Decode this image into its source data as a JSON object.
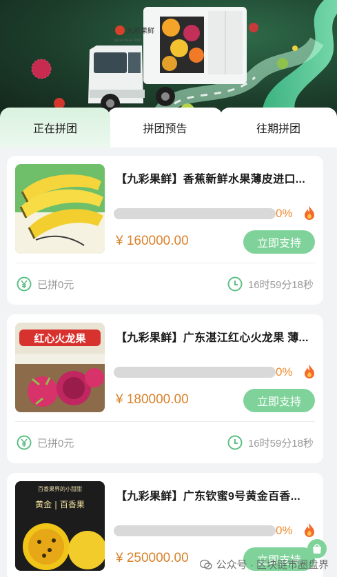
{
  "banner": {
    "logo_text": "九彩果鲜",
    "logo_sub": "JIUCAI FRESH FRUIT"
  },
  "tabs": [
    {
      "label": "正在拼团",
      "active": true
    },
    {
      "label": "拼团预告",
      "active": false
    },
    {
      "label": "往期拼团",
      "active": false
    }
  ],
  "products": [
    {
      "title": "【九彩果鲜】香蕉新鲜水果薄皮进口...",
      "progress_percent": 0,
      "progress_label": "0%",
      "price": "¥ 160000.00",
      "support_label": "立即支持",
      "joined_text": "已拼0元",
      "timer_text": "16时59分18秒",
      "image": "banana-bunch"
    },
    {
      "title": "【九彩果鲜】广东湛江红心火龙果 薄...",
      "progress_percent": 0,
      "progress_label": "0%",
      "price": "¥ 180000.00",
      "support_label": "立即支持",
      "joined_text": "已拼0元",
      "timer_text": "16时59分18秒",
      "image": "dragon-fruit",
      "image_caption": "红心火龙果"
    },
    {
      "title": "【九彩果鲜】广东钦蜜9号黄金百香...",
      "progress_percent": 0,
      "progress_label": "0%",
      "price": "¥ 250000.00",
      "support_label": "立即支持",
      "joined_text": "",
      "timer_text": "",
      "image": "passion-fruit",
      "image_caption_top": "百香果界的小甜甜",
      "image_caption": "黄金 | 百香果"
    }
  ],
  "watermark": {
    "text": "公众号 · 区块链市圈盘界"
  },
  "colors": {
    "accent": "#7fd39a",
    "price": "#d9822b",
    "percent": "#f08a2c"
  }
}
